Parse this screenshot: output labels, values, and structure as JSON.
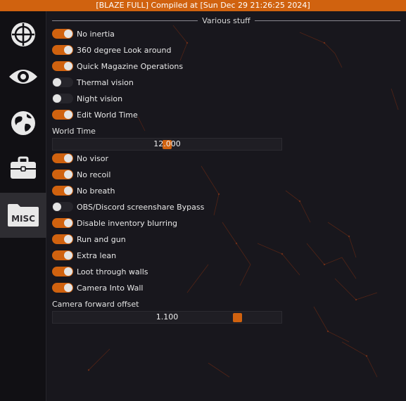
{
  "titlebar": {
    "text": "[BLAZE FULL] Compiled at [Sun Dec 29 21:26:25 2024]"
  },
  "sidebar": {
    "items": [
      {
        "icon": "crosshair-icon",
        "active": false
      },
      {
        "icon": "eye-icon",
        "active": false
      },
      {
        "icon": "globe-icon",
        "active": false
      },
      {
        "icon": "briefcase-icon",
        "active": false
      },
      {
        "icon": "folder-icon",
        "label": "MISC",
        "active": true
      }
    ]
  },
  "section": {
    "title": "Various stuff"
  },
  "toggles_top": [
    {
      "label": "No inertia",
      "on": true
    },
    {
      "label": "360 degree Look around",
      "on": true
    },
    {
      "label": "Quick Magazine Operations",
      "on": true
    },
    {
      "label": "Thermal vision",
      "on": false
    },
    {
      "label": "Night vision",
      "on": false
    },
    {
      "label": "Edit World Time",
      "on": true
    }
  ],
  "world_time": {
    "label": "World Time",
    "value": "12.000",
    "fraction": 0.5
  },
  "toggles_bottom": [
    {
      "label": "No visor",
      "on": true
    },
    {
      "label": "No recoil",
      "on": true
    },
    {
      "label": "No breath",
      "on": true
    },
    {
      "label": "OBS/Discord screenshare Bypass",
      "on": false
    },
    {
      "label": "Disable inventory blurring",
      "on": true
    },
    {
      "label": "Run and gun",
      "on": true
    },
    {
      "label": "Extra lean",
      "on": true
    },
    {
      "label": "Loot through walls",
      "on": true
    },
    {
      "label": "Camera Into Wall",
      "on": true
    }
  ],
  "camera_offset": {
    "label": "Camera forward offset",
    "value": "1.100",
    "fraction": 0.82
  },
  "colors": {
    "accent": "#d0620f",
    "background": "#18171d",
    "sidebar": "#111014",
    "active_tab": "#2e2d32"
  }
}
